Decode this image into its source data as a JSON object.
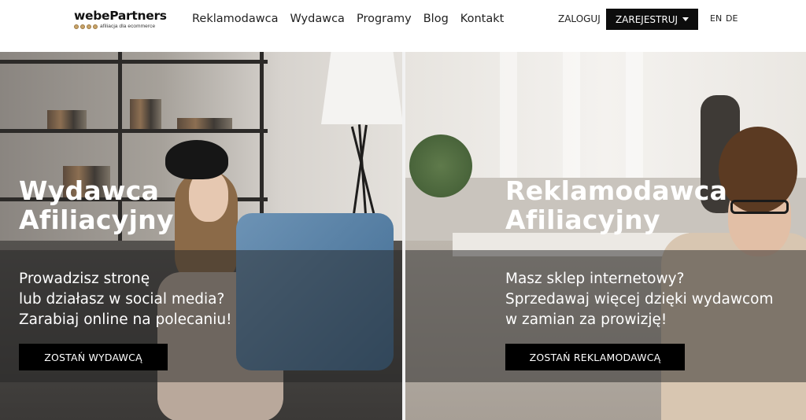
{
  "header": {
    "logo": {
      "name": "webePartners",
      "tagline": "afiliacja dla ecommerce"
    },
    "nav": [
      {
        "label": "Reklamodawca"
      },
      {
        "label": "Wydawca"
      },
      {
        "label": "Programy"
      },
      {
        "label": "Blog"
      },
      {
        "label": "Kontakt"
      }
    ],
    "login_label": "ZALOGUJ",
    "register_label": "ZAREJESTRUJ",
    "languages": [
      "EN",
      "DE"
    ]
  },
  "hero": {
    "left": {
      "title_line1": "Wydawca",
      "title_line2": "Afiliacyjny",
      "text_lines": [
        "Prowadzisz stronę",
        "lub działasz w social media?",
        "Zarabiaj online na polecaniu!"
      ],
      "cta_label": "ZOSTAŃ WYDAWCĄ"
    },
    "right": {
      "title_line1": "Reklamodawca",
      "title_line2": "Afiliacyjny",
      "text_lines": [
        "Masz sklep internetowy?",
        "Sprzedawaj więcej dzięki wydawcom",
        "w zamian za prowizję!"
      ],
      "cta_label": "ZOSTAŃ REKLAMODAWCĄ"
    }
  },
  "colors": {
    "cta_background": "#000000",
    "register_background": "#0d0d0d",
    "hero_text": "#ffffff"
  }
}
